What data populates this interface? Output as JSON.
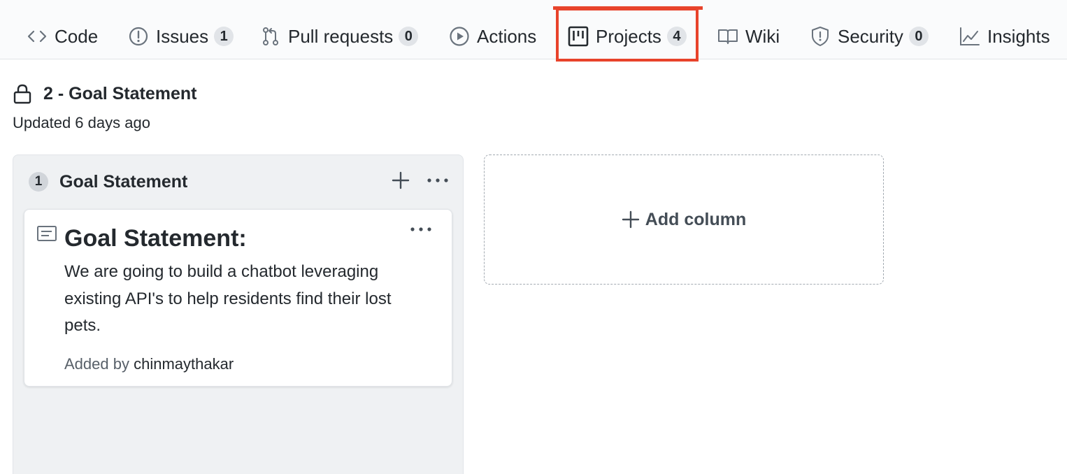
{
  "nav": {
    "tabs": [
      {
        "label": "Code",
        "icon": "code-icon",
        "counter": null
      },
      {
        "label": "Issues",
        "icon": "issue-icon",
        "counter": "1"
      },
      {
        "label": "Pull requests",
        "icon": "pull-request-icon",
        "counter": "0"
      },
      {
        "label": "Actions",
        "icon": "play-icon",
        "counter": null
      },
      {
        "label": "Projects",
        "icon": "project-board-icon",
        "counter": "4",
        "selected": true,
        "highlight_color": "#e8432b"
      },
      {
        "label": "Wiki",
        "icon": "book-icon",
        "counter": null
      },
      {
        "label": "Security",
        "icon": "shield-icon",
        "counter": "0"
      },
      {
        "label": "Insights",
        "icon": "graph-icon",
        "counter": null
      }
    ]
  },
  "project": {
    "icon": "lock-icon",
    "title": "2 - Goal Statement",
    "updated": "Updated 6 days ago"
  },
  "column": {
    "count": "1",
    "name": "Goal Statement",
    "card": {
      "icon": "note-icon",
      "title": "Goal Statement:",
      "body": "We are going to build a chatbot leveraging existing API's to help residents find their lost pets.",
      "added_by_label": "Added by",
      "author": "chinmaythakar"
    }
  },
  "add_column": {
    "label": "Add column"
  },
  "colors": {
    "accent_highlight": "#e8432b",
    "nav_bg": "#fafbfc",
    "column_bg": "#eff1f3"
  }
}
